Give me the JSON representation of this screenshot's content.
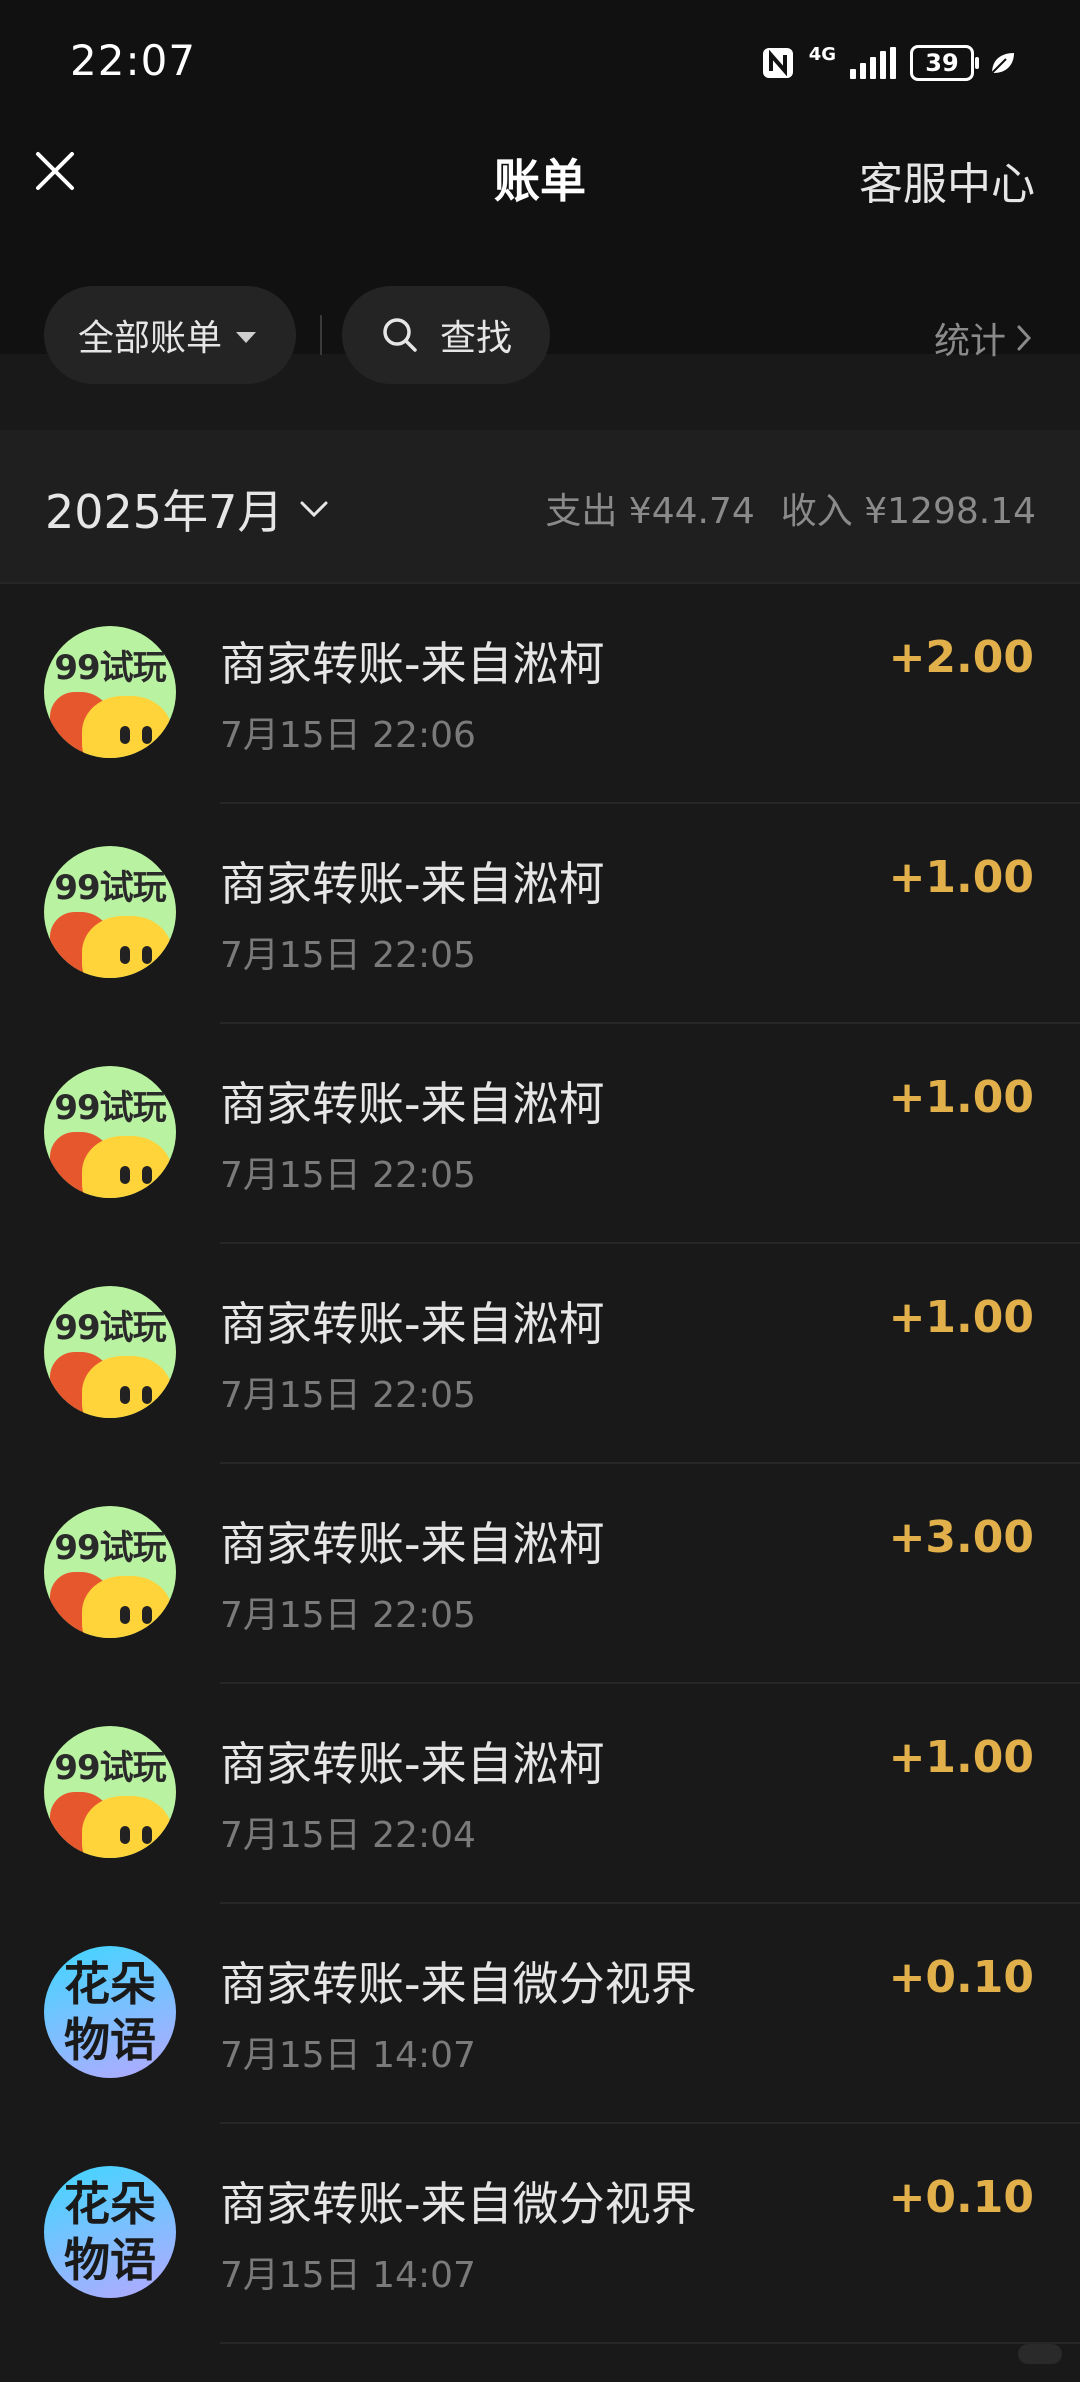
{
  "status": {
    "time": "22:07",
    "network": "4G",
    "battery": "39"
  },
  "header": {
    "title": "账单",
    "service": "客服中心"
  },
  "filters": {
    "all_bills": "全部账单",
    "search": "查找",
    "stats": "统计"
  },
  "month": {
    "label": "2025年7月",
    "expense": "支出 ¥44.74",
    "income": "收入 ¥1298.14"
  },
  "transactions": [
    {
      "avatar": "99试玩",
      "title": "商家转账-来自淞柯",
      "time": "7月15日 22:06",
      "amount": "+2.00"
    },
    {
      "avatar": "99试玩",
      "title": "商家转账-来自淞柯",
      "time": "7月15日 22:05",
      "amount": "+1.00"
    },
    {
      "avatar": "99试玩",
      "title": "商家转账-来自淞柯",
      "time": "7月15日 22:05",
      "amount": "+1.00"
    },
    {
      "avatar": "99试玩",
      "title": "商家转账-来自淞柯",
      "time": "7月15日 22:05",
      "amount": "+1.00"
    },
    {
      "avatar": "99试玩",
      "title": "商家转账-来自淞柯",
      "time": "7月15日 22:05",
      "amount": "+3.00"
    },
    {
      "avatar": "99试玩",
      "title": "商家转账-来自淞柯",
      "time": "7月15日 22:04",
      "amount": "+1.00"
    },
    {
      "avatar": "花朵物语",
      "title": "商家转账-来自微分视界",
      "time": "7月15日 14:07",
      "amount": "+0.10"
    },
    {
      "avatar": "花朵物语",
      "title": "商家转账-来自微分视界",
      "time": "7月15日 14:07",
      "amount": "+0.10"
    }
  ],
  "colors": {
    "background": "#191919",
    "amount": "#e2b04a",
    "secondary_text": "#7a7a7a"
  }
}
